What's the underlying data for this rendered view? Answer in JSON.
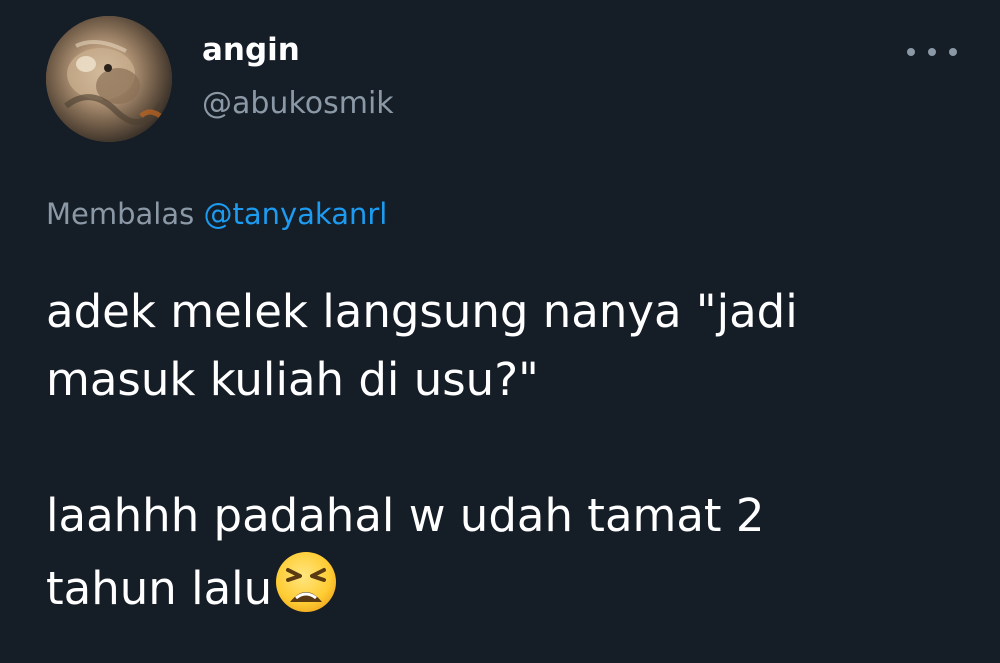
{
  "author": {
    "display_name": "angin",
    "handle": "@abukosmik"
  },
  "reply": {
    "prefix": "Membalas",
    "mention": "@tanyakanrl"
  },
  "tweet": {
    "line1": "adek melek langsung nanya \"jadi",
    "line2": "masuk kuliah di usu?\"",
    "line3": "laahhh padahal w udah tamat 2",
    "line4": "tahun lalu",
    "emoji": "tired-face-emoji"
  },
  "icons": {
    "more": "more-options-icon"
  },
  "colors": {
    "background": "#151d27",
    "secondary_text": "#8b98a5",
    "link": "#1d9bf0",
    "primary_text": "#ffffff"
  }
}
